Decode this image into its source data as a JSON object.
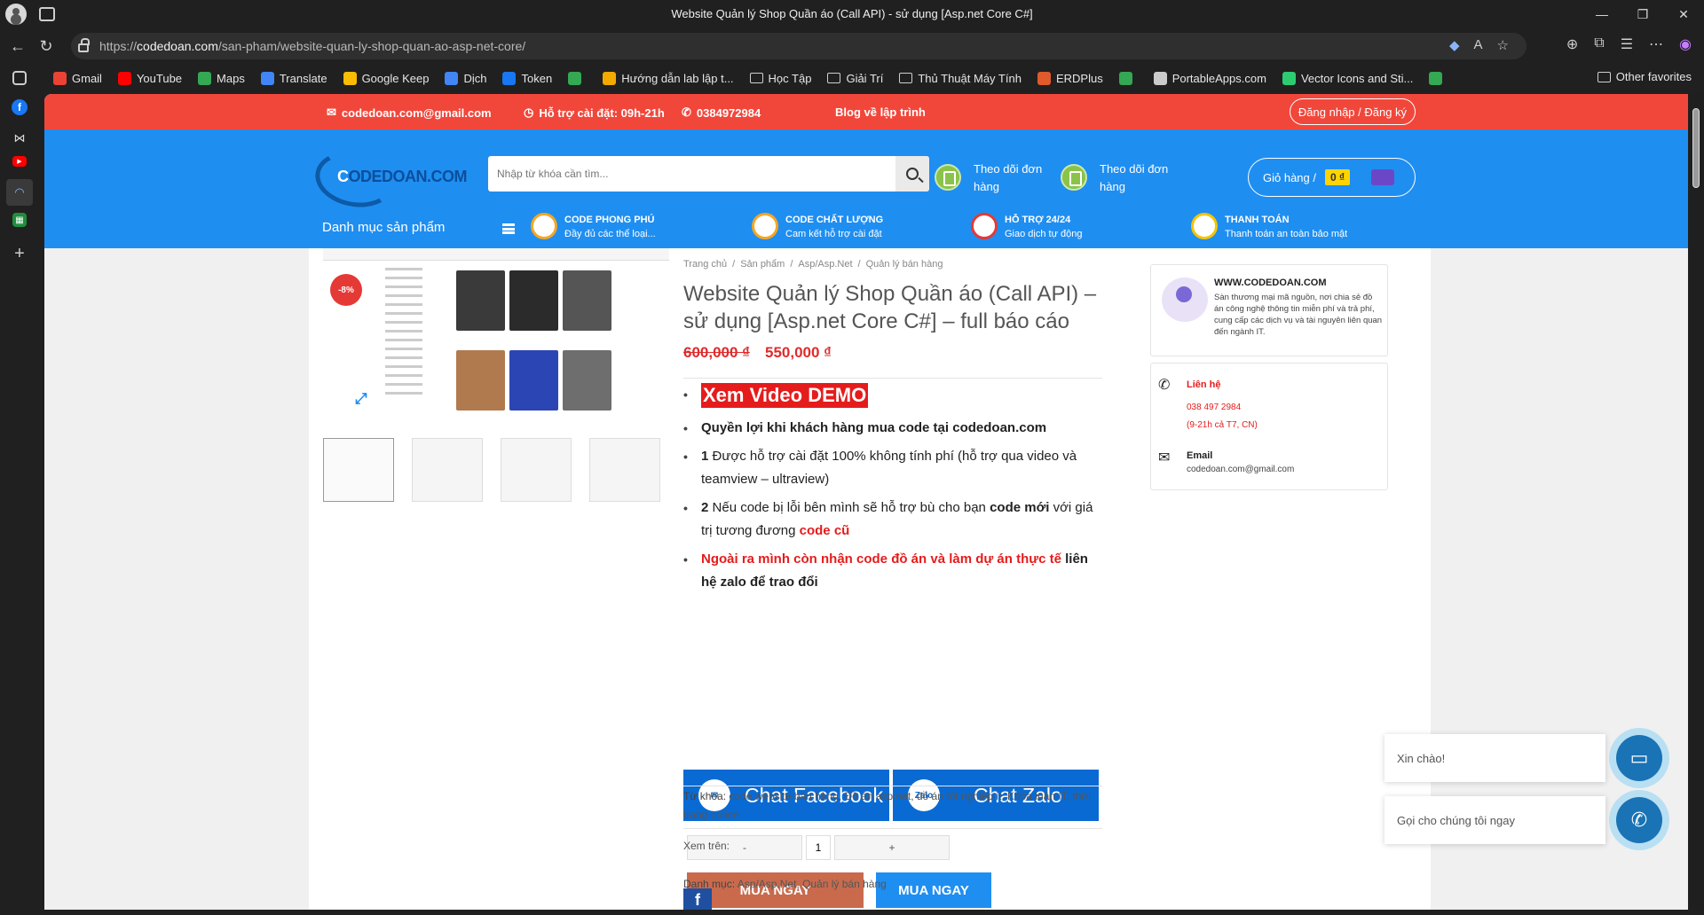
{
  "browser": {
    "tab_title": "Website Quản lý Shop Quần áo (Call API) - sử dụng [Asp.net Core C#]",
    "url_prefix": "https://",
    "url_host": "codedoan.com",
    "url_path": "/san-pham/website-quan-ly-shop-quan-ao-asp-net-core/",
    "bookmarks": [
      {
        "label": "Gmail",
        "color": "#ea4335"
      },
      {
        "label": "YouTube",
        "color": "#ff0000"
      },
      {
        "label": "Maps",
        "color": "#34a853"
      },
      {
        "label": "Translate",
        "color": "#4285f4"
      },
      {
        "label": "Google Keep",
        "color": "#fbbc04"
      },
      {
        "label": "Dịch",
        "color": "#4285f4"
      },
      {
        "label": "Token",
        "color": "#1877f2"
      },
      {
        "label": "",
        "color": "#34a853"
      },
      {
        "label": "Hướng dẫn lab lập t...",
        "color": "#f2a900"
      },
      {
        "label": "Học Tập",
        "color": "folder"
      },
      {
        "label": "Giải Trí",
        "color": "folder"
      },
      {
        "label": "Thủ Thuật Máy Tính",
        "color": "folder"
      },
      {
        "label": "ERDPlus",
        "color": "#e05a2b"
      },
      {
        "label": "",
        "color": "#34a853"
      },
      {
        "label": "PortableApps.com",
        "color": "#cccccc"
      },
      {
        "label": "Vector Icons and Sti...",
        "color": "#2ecc71"
      },
      {
        "label": "",
        "color": "#34a853"
      }
    ],
    "other_favorites": "Other favorites"
  },
  "topbar": {
    "email": "codedoan.com@gmail.com",
    "support": "Hỗ trợ cài đặt: 09h-21h",
    "phone": "0384972984",
    "blog": "Blog về lập trình",
    "login": "Đăng nhập / Đăng ký"
  },
  "header": {
    "logo_main": "C",
    "logo_rest": "ODEDOAN.COM",
    "search_placeholder": "Nhập từ khóa cần tìm...",
    "track1": "Theo dõi đơn hàng",
    "track2": "Theo dõi đơn hàng",
    "cart_label": "Giỏ hàng /",
    "cart_amount": "0 ₫",
    "category_menu": "Danh mục sản phẩm",
    "features": [
      {
        "title": "CODE PHONG PHÚ",
        "sub": "Đầy đủ các thể loại..."
      },
      {
        "title": "CODE CHẤT LƯỢNG",
        "sub": "Cam kết hỗ trợ cài đặt"
      },
      {
        "title": "HỖ TRỢ 24/24",
        "sub": "Giao dịch tự động"
      },
      {
        "title": "THANH TOÁN",
        "sub": "Thanh toán an toàn bảo mật"
      }
    ]
  },
  "product": {
    "sale_badge": "-8%",
    "breadcrumb": [
      "Trang chủ",
      "/",
      "Sản phẩm",
      "/",
      "Asp/Asp.Net",
      "/",
      "Quản lý bán hàng"
    ],
    "title": "Website Quản lý Shop Quần áo (Call API) – sử dụng [Asp.net Core C#] – full báo cáo",
    "price_old": "600,000 ₫",
    "price_new": "550,000 ₫",
    "video_demo": "Xem Video DEMO",
    "benefit_1a": "Quyền lợi khi khách hàng mua code tại ",
    "benefit_1b": "codedoan.com",
    "benefit_2a": "1 ",
    "benefit_2b": "Được hỗ trợ cài đặt 100% không tính phí (hỗ trợ qua video và teamview – ultraview)",
    "benefit_3a": "2 ",
    "benefit_3b": "Nếu code bị lỗi bên mình sẽ hỗ trợ bù cho bạn ",
    "benefit_3c": "code mới",
    "benefit_3d": " với giá trị tương đương ",
    "benefit_3e": "code cũ",
    "benefit_4a": "Ngoài ra mình còn nhận code đồ án và làm dự án thực tế",
    "benefit_4b": " liên hệ zalo để trao đổi",
    "chat_facebook": "Chat Facebook",
    "chat_zalo": "Chat Zalo",
    "zalo_icon": "Zalo",
    "qty_minus": "-",
    "qty_value": "1",
    "qty_plus": "+",
    "buy_now_1": "MUA NGAY",
    "buy_now_2": "MUA NGAY",
    "category_label": "Danh mục: ",
    "category_value": "Asp/Asp.Net, Quản lý bán hàng",
    "tags_label": "Từ khóa: ",
    "tags_value": "code website bán hàng, Đồ án asp.net, đồ án tốt nghiệp it, Khóa luận IT, thời trang online",
    "share_label": "Xem trên:",
    "share_fb": "f"
  },
  "sidebar_info": {
    "site": "WWW.CODEDOAN.COM",
    "desc": "Sàn thương mại mã nguồn, nơi chia sẻ đồ án công nghệ thông tin miễn phí và trả phí, cung cấp các dịch vụ và tài nguyên liên quan đến ngành IT.",
    "contact_label": "Liên hệ",
    "contact_phone": "038 497 2984",
    "contact_hours": "(9-21h cả T7, CN)",
    "email_label": "Email",
    "email_value": "codedoan.com@gmail.com"
  },
  "floating": {
    "hello": "Xin chào!",
    "call": "Gọi cho chúng tôi ngay"
  }
}
